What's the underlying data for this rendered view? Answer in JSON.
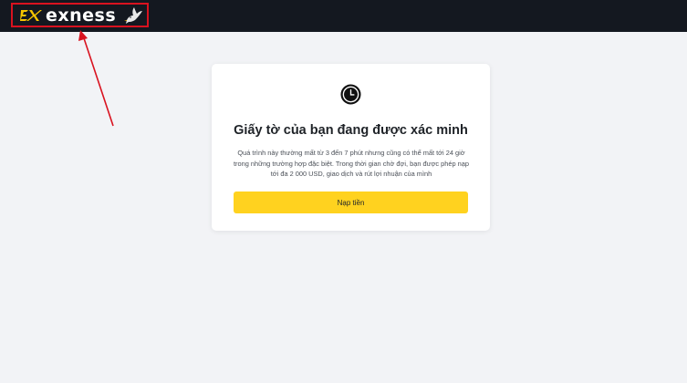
{
  "header": {
    "brand_name": "exness",
    "logo_icon": "exness-logo-mark",
    "dove_icon": "dove-icon",
    "background_color": "#141820",
    "highlight_color": "#d9121f"
  },
  "card": {
    "status_icon": "clock-icon",
    "title": "Giấy tờ của bạn đang được xác minh",
    "description": "Quá trình này thường mất từ 3 đến 7 phút nhưng cũng có thể mất tới 24 giờ trong những trường hợp đặc biệt. Trong thời gian chờ đợi, bạn được phép nạp tới đa 2 000 USD, giao dịch và rút lợi nhuận của mình",
    "button_label": "Nạp tiền",
    "button_color": "#ffd21f"
  },
  "annotation": {
    "arrow_color": "#d9121f"
  }
}
